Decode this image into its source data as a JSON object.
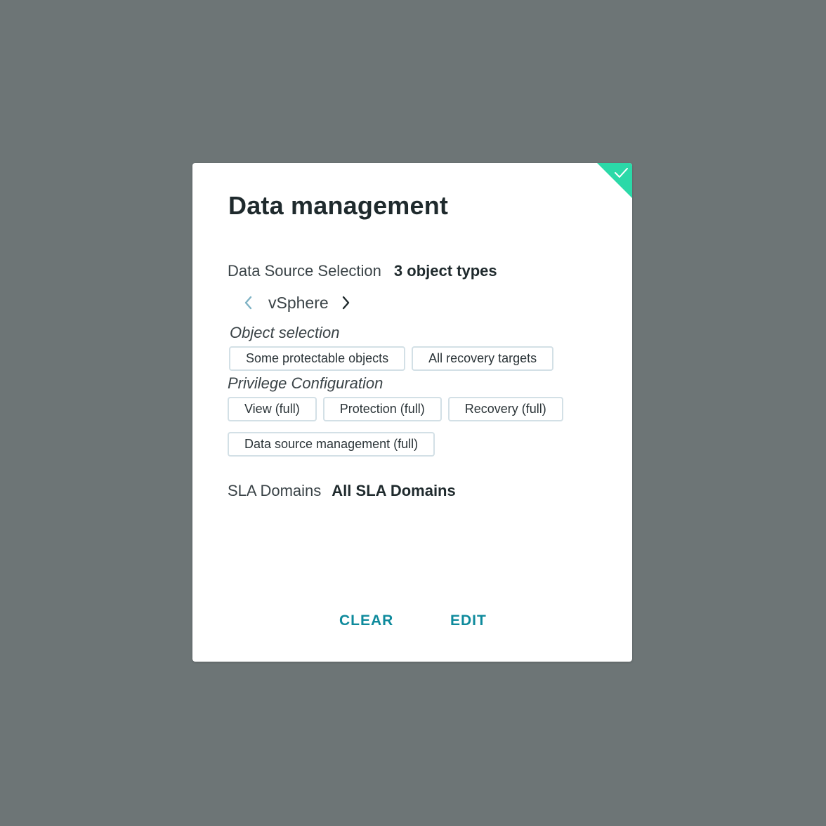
{
  "card": {
    "title": "Data management",
    "status_icon": "checkmark-icon",
    "accent_color": "#2bd9a8"
  },
  "data_source": {
    "label": "Data Source Selection",
    "value": "3 object types",
    "current": "vSphere",
    "prev_icon": "chevron-left-icon",
    "next_icon": "chevron-right-icon"
  },
  "object_selection": {
    "label": "Object selection",
    "chips": [
      "Some protectable objects",
      "All recovery targets"
    ]
  },
  "privilege_configuration": {
    "label": "Privilege Configuration",
    "chips": [
      "View (full)",
      "Protection (full)",
      "Recovery (full)",
      "Data source management (full)"
    ]
  },
  "sla": {
    "label": "SLA Domains",
    "value": "All SLA Domains"
  },
  "actions": {
    "clear_label": "CLEAR",
    "edit_label": "EDIT",
    "color": "#0e8a9c"
  }
}
